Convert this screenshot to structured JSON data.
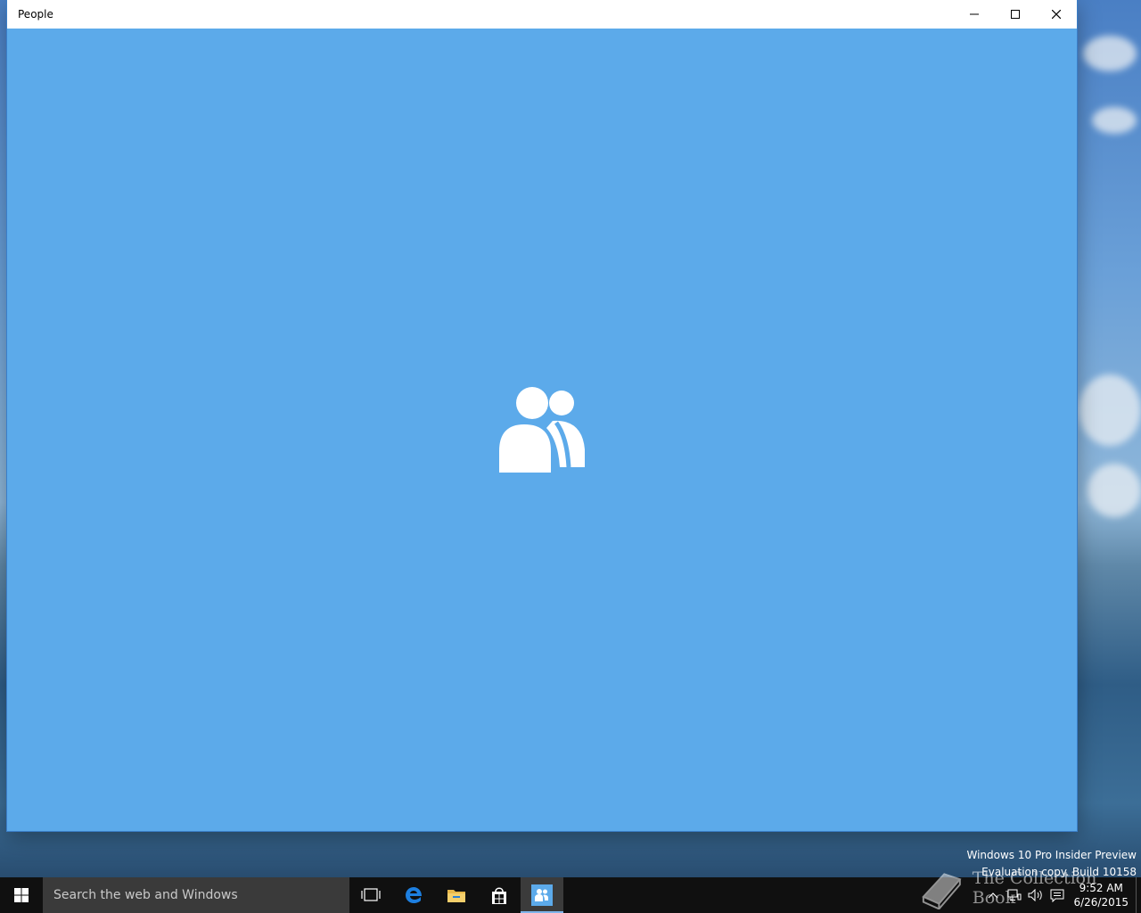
{
  "window": {
    "title": "People",
    "minimize_icon": "minimize-icon",
    "maximize_icon": "maximize-icon",
    "close_icon": "close-icon",
    "splash_icon": "people-icon",
    "background_color": "#5caaea"
  },
  "watermark": {
    "line1": "Windows 10 Pro Insider Preview",
    "line2": "Evaluation copy. Build 10158"
  },
  "taskbar": {
    "start_icon": "windows-logo-icon",
    "search_placeholder": "Search the web and Windows",
    "apps": [
      {
        "name": "task-view-icon"
      },
      {
        "name": "edge-icon"
      },
      {
        "name": "file-explorer-icon"
      },
      {
        "name": "store-icon"
      },
      {
        "name": "people-app-icon",
        "active": true
      }
    ],
    "tray": {
      "chevron_icon": "chevron-up-icon",
      "network_icon": "network-icon",
      "volume_icon": "volume-icon",
      "action_center_icon": "action-center-icon",
      "time": "9:52 AM",
      "date": "6/26/2015"
    },
    "overlay_text": "The Collection Book"
  }
}
